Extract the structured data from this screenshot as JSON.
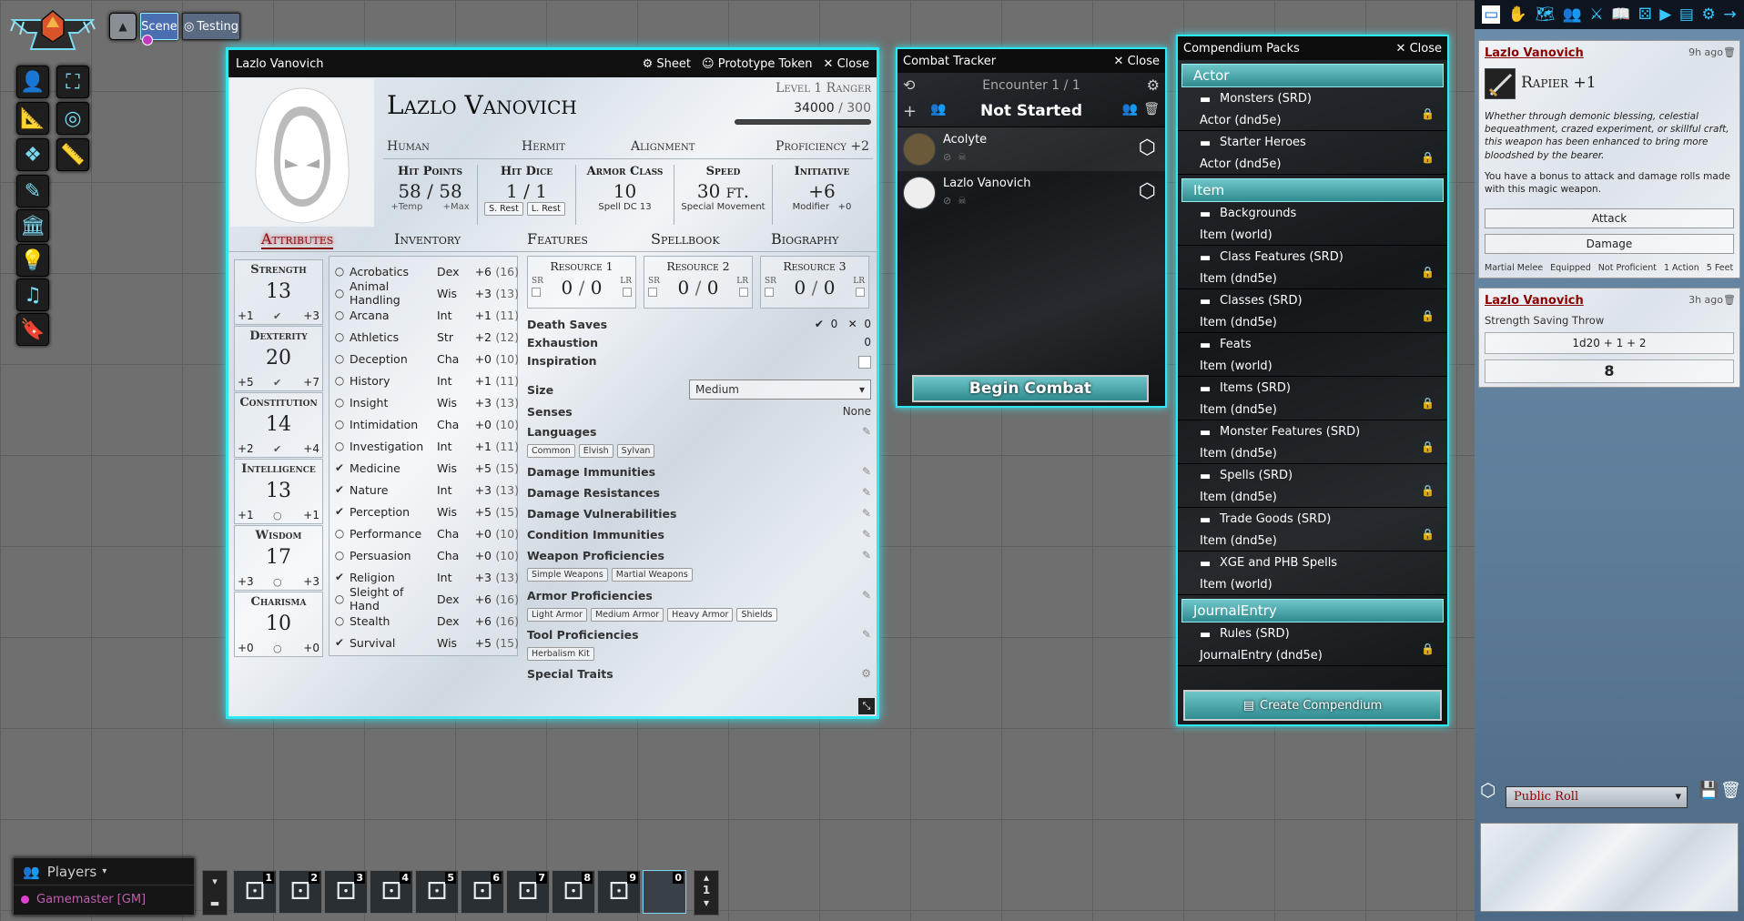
{
  "scene_controls": {
    "scene_label": "Scene",
    "testing_label": "Testing"
  },
  "sheet": {
    "window_title": "Lazlo Vanovich",
    "header_actions": {
      "sheet": "Sheet",
      "token": "Prototype Token",
      "close": "Close"
    },
    "name": "Lazlo Vanovich",
    "level": "Level 1 Ranger",
    "xp_current": "34000",
    "xp_max": "300",
    "race": "Human",
    "background": "Hermit",
    "alignment": "Alignment",
    "proficiency": "Proficiency +2",
    "hp": {
      "label": "Hit Points",
      "value": "58",
      "max": "58",
      "temp": "+Temp",
      "tmax": "+Max"
    },
    "hit_dice": {
      "label": "Hit Dice",
      "value": "1",
      "max": "1",
      "srest": "S. Rest",
      "lrest": "L. Rest"
    },
    "ac": {
      "label": "Armor Class",
      "value": "10",
      "sub": "Spell DC 13"
    },
    "speed": {
      "label": "Speed",
      "value": "30 ft.",
      "sub": "Special Movement"
    },
    "initiative": {
      "label": "Initiative",
      "value": "+6",
      "sub_label": "Modifier",
      "sub_val": "+0"
    },
    "tabs": [
      "Attributes",
      "Inventory",
      "Features",
      "Spellbook",
      "Biography"
    ],
    "abilities": [
      {
        "name": "Strength",
        "value": "13",
        "mod": "+1",
        "save": "+3",
        "prof": "✔"
      },
      {
        "name": "Dexterity",
        "value": "20",
        "mod": "+5",
        "save": "+7",
        "prof": "✔"
      },
      {
        "name": "Constitution",
        "value": "14",
        "mod": "+2",
        "save": "+4",
        "prof": "✔"
      },
      {
        "name": "Intelligence",
        "value": "13",
        "mod": "+1",
        "save": "+1",
        "prof": "○"
      },
      {
        "name": "Wisdom",
        "value": "17",
        "mod": "+3",
        "save": "+3",
        "prof": "○"
      },
      {
        "name": "Charisma",
        "value": "10",
        "mod": "+0",
        "save": "+0",
        "prof": "○"
      }
    ],
    "skills": [
      {
        "mark": "○",
        "name": "Acrobatics",
        "ability": "Dex",
        "mod": "+6",
        "passive": "(16)"
      },
      {
        "mark": "○",
        "name": "Animal Handling",
        "ability": "Wis",
        "mod": "+3",
        "passive": "(13)"
      },
      {
        "mark": "○",
        "name": "Arcana",
        "ability": "Int",
        "mod": "+1",
        "passive": "(11)"
      },
      {
        "mark": "○",
        "name": "Athletics",
        "ability": "Str",
        "mod": "+2",
        "passive": "(12)"
      },
      {
        "mark": "○",
        "name": "Deception",
        "ability": "Cha",
        "mod": "+0",
        "passive": "(10)"
      },
      {
        "mark": "○",
        "name": "History",
        "ability": "Int",
        "mod": "+1",
        "passive": "(11)"
      },
      {
        "mark": "○",
        "name": "Insight",
        "ability": "Wis",
        "mod": "+3",
        "passive": "(13)"
      },
      {
        "mark": "○",
        "name": "Intimidation",
        "ability": "Cha",
        "mod": "+0",
        "passive": "(10)"
      },
      {
        "mark": "○",
        "name": "Investigation",
        "ability": "Int",
        "mod": "+1",
        "passive": "(11)"
      },
      {
        "mark": "✔",
        "name": "Medicine",
        "ability": "Wis",
        "mod": "+5",
        "passive": "(15)"
      },
      {
        "mark": "✔",
        "name": "Nature",
        "ability": "Int",
        "mod": "+3",
        "passive": "(13)"
      },
      {
        "mark": "✔",
        "name": "Perception",
        "ability": "Wis",
        "mod": "+5",
        "passive": "(15)"
      },
      {
        "mark": "○",
        "name": "Performance",
        "ability": "Cha",
        "mod": "+0",
        "passive": "(10)"
      },
      {
        "mark": "○",
        "name": "Persuasion",
        "ability": "Cha",
        "mod": "+0",
        "passive": "(10)"
      },
      {
        "mark": "✔",
        "name": "Religion",
        "ability": "Int",
        "mod": "+3",
        "passive": "(13)"
      },
      {
        "mark": "○",
        "name": "Sleight of Hand",
        "ability": "Dex",
        "mod": "+6",
        "passive": "(16)"
      },
      {
        "mark": "○",
        "name": "Stealth",
        "ability": "Dex",
        "mod": "+6",
        "passive": "(16)"
      },
      {
        "mark": "✔",
        "name": "Survival",
        "ability": "Wis",
        "mod": "+5",
        "passive": "(15)"
      }
    ],
    "resources": [
      {
        "label": "Resource 1",
        "sr": "SR",
        "lr": "LR",
        "value": "0",
        "max": "0"
      },
      {
        "label": "Resource 2",
        "sr": "SR",
        "lr": "LR",
        "value": "0",
        "max": "0"
      },
      {
        "label": "Resource 3",
        "sr": "SR",
        "lr": "LR",
        "value": "0",
        "max": "0"
      }
    ],
    "death_saves": {
      "label": "Death Saves",
      "success": "0",
      "failure": "0"
    },
    "exhaustion": {
      "label": "Exhaustion",
      "value": "0"
    },
    "inspiration": {
      "label": "Inspiration"
    },
    "size": {
      "label": "Size",
      "value": "Medium"
    },
    "senses": {
      "label": "Senses",
      "value": "None"
    },
    "languages": {
      "label": "Languages",
      "tags": [
        "Common",
        "Elvish",
        "Sylvan"
      ]
    },
    "damage_immunities": "Damage Immunities",
    "damage_resistances": "Damage Resistances",
    "damage_vulnerabilities": "Damage Vulnerabilities",
    "condition_immunities": "Condition Immunities",
    "weapon_prof": {
      "label": "Weapon Proficiencies",
      "tags": [
        "Simple Weapons",
        "Martial Weapons"
      ]
    },
    "armor_prof": {
      "label": "Armor Proficiencies",
      "tags": [
        "Light Armor",
        "Medium Armor",
        "Heavy Armor",
        "Shields"
      ]
    },
    "tool_prof": {
      "label": "Tool Proficiencies",
      "tags": [
        "Herbalism Kit"
      ]
    },
    "special_traits": "Special Traits"
  },
  "combat": {
    "title": "Combat Tracker",
    "close": "Close",
    "encounter": "Encounter 1 / 1",
    "status": "Not Started",
    "combatants": [
      {
        "name": "Acolyte"
      },
      {
        "name": "Lazlo Vanovich"
      }
    ],
    "begin": "Begin Combat"
  },
  "compendium": {
    "title": "Compendium Packs",
    "close": "Close",
    "groups": [
      {
        "name": "Actor",
        "packs": [
          {
            "name": "Monsters (SRD)",
            "sub": "Actor (dnd5e)",
            "locked": true
          },
          {
            "name": "Starter Heroes",
            "sub": "Actor (dnd5e)",
            "locked": true
          }
        ]
      },
      {
        "name": "Item",
        "packs": [
          {
            "name": "Backgrounds",
            "sub": "Item (world)",
            "locked": false
          },
          {
            "name": "Class Features (SRD)",
            "sub": "Item (dnd5e)",
            "locked": true
          },
          {
            "name": "Classes (SRD)",
            "sub": "Item (dnd5e)",
            "locked": true
          },
          {
            "name": "Feats",
            "sub": "Item (world)",
            "locked": false
          },
          {
            "name": "Items (SRD)",
            "sub": "Item (dnd5e)",
            "locked": true
          },
          {
            "name": "Monster Features (SRD)",
            "sub": "Item (dnd5e)",
            "locked": true
          },
          {
            "name": "Spells (SRD)",
            "sub": "Item (dnd5e)",
            "locked": true
          },
          {
            "name": "Trade Goods (SRD)",
            "sub": "Item (dnd5e)",
            "locked": true
          },
          {
            "name": "XGE and PHB Spells",
            "sub": "Item (world)",
            "locked": false
          }
        ]
      },
      {
        "name": "JournalEntry",
        "packs": [
          {
            "name": "Rules (SRD)",
            "sub": "JournalEntry (dnd5e)",
            "locked": true
          }
        ]
      }
    ],
    "create": "Create Compendium"
  },
  "chat": {
    "msg1": {
      "speaker": "Lazlo Vanovich",
      "time": "9h ago",
      "item": "Rapier +1",
      "desc": "Whether through demonic blessing, celestial bequeathment, crazed experiment, or skillful craft, this weapon has been enhanced to bring more bloodshed by the bearer.",
      "desc2": "You have a bonus to attack and damage rolls made with this magic weapon.",
      "attack": "Attack",
      "damage": "Damage",
      "tags": [
        "Martial Melee",
        "Equipped",
        "Not Proficient",
        "1 Action",
        "5 Feet"
      ]
    },
    "msg2": {
      "speaker": "Lazlo Vanovich",
      "time": "3h ago",
      "flavor": "Strength Saving Throw",
      "formula": "1d20 + 1 + 2",
      "total": "8"
    },
    "roll_mode": "Public Roll"
  },
  "players": {
    "title": "Players",
    "gm": "Gamemaster [GM]"
  },
  "hotbar": {
    "slots": [
      "1",
      "2",
      "3",
      "4",
      "5",
      "6",
      "7",
      "8",
      "9",
      "0"
    ],
    "page": "1"
  }
}
